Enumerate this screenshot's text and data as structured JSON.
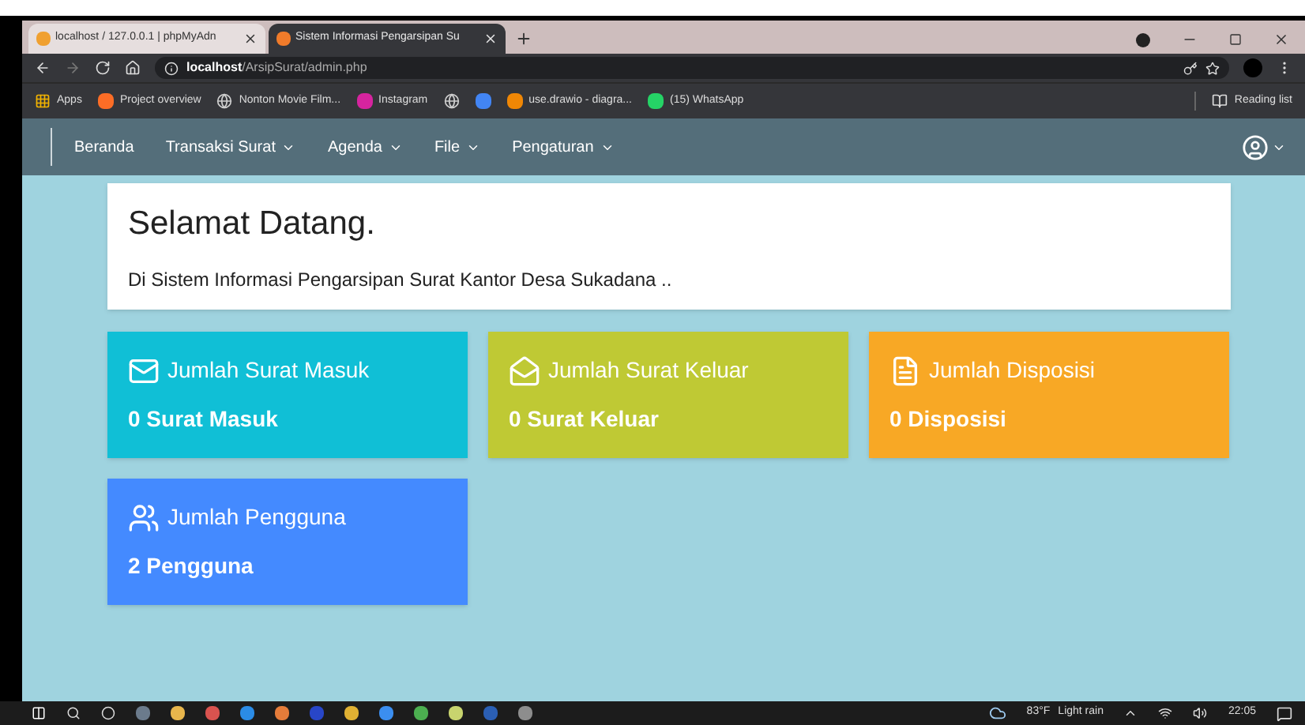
{
  "browser": {
    "tabs": [
      {
        "title": "localhost / 127.0.0.1 | phpMyAdn",
        "selected": false,
        "kind": "pma"
      },
      {
        "title": "Sistem Informasi Pengarsipan Su",
        "selected": true,
        "kind": "app"
      }
    ],
    "address": {
      "host": "localhost",
      "path": "/ArsipSurat/admin.php"
    },
    "bookmarks": [
      {
        "label": "Apps",
        "kind": "apps"
      },
      {
        "label": "Project overview",
        "kind": "gitlab"
      },
      {
        "label": "Nonton Movie Film...",
        "kind": "globe"
      },
      {
        "label": "Instagram",
        "kind": "instagram"
      },
      {
        "kind": "globe"
      },
      {
        "kind": "google"
      },
      {
        "label": "use.drawio - diagra...",
        "kind": "drawio"
      },
      {
        "label": "(15) WhatsApp",
        "kind": "whatsapp"
      }
    ],
    "reading_list": "Reading list"
  },
  "navbar": {
    "items": [
      {
        "label": "Beranda",
        "dropdown": false
      },
      {
        "label": "Transaksi Surat",
        "dropdown": true
      },
      {
        "label": "Agenda",
        "dropdown": true
      },
      {
        "label": "File",
        "dropdown": true
      },
      {
        "label": "Pengaturan",
        "dropdown": true
      }
    ]
  },
  "welcome": {
    "title": "Selamat Datang.",
    "subtitle": "Di Sistem Informasi Pengarsipan Surat Kantor Desa Sukadana .."
  },
  "cards": [
    {
      "title": "Jumlah Surat Masuk",
      "value": "0 Surat Masuk",
      "color": "#10bfd6",
      "kind": "mail"
    },
    {
      "title": "Jumlah Surat Keluar",
      "value": "0 Surat Keluar",
      "color": "#bfc934",
      "kind": "mail-open"
    },
    {
      "title": "Jumlah Disposisi",
      "value": "0 Disposisi",
      "color": "#f8a825",
      "kind": "file"
    },
    {
      "title": "Jumlah Pengguna",
      "value": "2 Pengguna",
      "color": "#448aff",
      "kind": "users"
    }
  ],
  "taskbar": {
    "weather": "83°F",
    "condition": "Light rain",
    "time": "22:05"
  }
}
